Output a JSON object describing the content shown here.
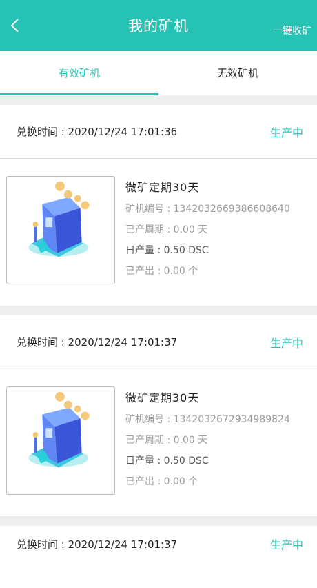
{
  "header": {
    "title": "我的矿机",
    "action": "一键收矿"
  },
  "tabs": [
    {
      "label": "有效矿机",
      "active": true
    },
    {
      "label": "无效矿机",
      "active": false
    }
  ],
  "colors": {
    "accent": "#26c3b5"
  },
  "cards": [
    {
      "exchange_time": "兑换时间 : 2020/12/24 17:01:36",
      "status": "生产中",
      "name": "微矿定期30天",
      "machine_no": "矿机编号 : 1342032669386608640",
      "period": "已产周期 :  0.00 天",
      "daily_output": "日产量  : 0.50 DSC",
      "produced": "已产出 : 0.00 个"
    },
    {
      "exchange_time": "兑换时间 : 2020/12/24 17:01:37",
      "status": "生产中",
      "name": "微矿定期30天",
      "machine_no": "矿机编号 : 1342032672934989824",
      "period": "已产周期 :  0.00 天",
      "daily_output": "日产量  : 0.50 DSC",
      "produced": "已产出 : 0.00 个"
    },
    {
      "exchange_time": "兑换时间 : 2020/12/24 17:01:37",
      "status": "生产中"
    }
  ]
}
